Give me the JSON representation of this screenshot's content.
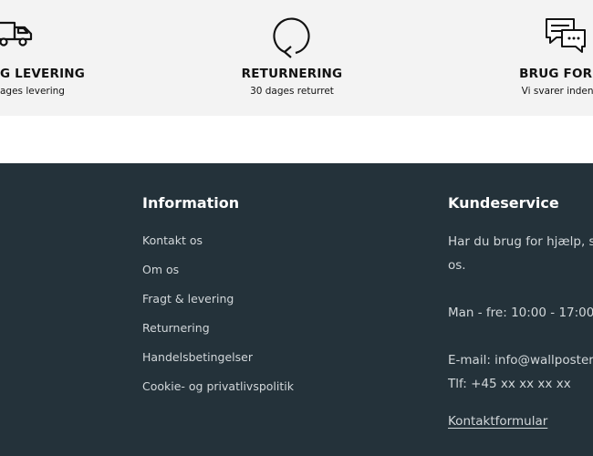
{
  "features": [
    {
      "icon": "delivery-truck-icon",
      "title": "G LEVERING",
      "subtitle": "ages levering"
    },
    {
      "icon": "return-arrow-icon",
      "title": "RETURNERING",
      "subtitle": "30 dages returret"
    },
    {
      "icon": "chat-bubbles-icon",
      "title": "BRUG FOR HJ",
      "subtitle": "Vi svarer inden for"
    }
  ],
  "footer": {
    "information": {
      "title": "Information",
      "links": [
        "Kontakt os",
        "Om os",
        "Fragt & levering",
        "Returnering",
        "Handelsbetingelser",
        "Cookie- og privatlivspolitik"
      ]
    },
    "kundeservice": {
      "title": "Kundeservice",
      "help_line1": "Har du brug for hjælp, så",
      "help_line2": "os.",
      "hours": "Man - fre: 10:00 - 17:00",
      "email": "E-mail: info@wallposters",
      "phone": "Tlf: +45 xx xx xx xx",
      "form_link": "Kontaktformular"
    }
  },
  "colors": {
    "footer_bg": "#24323a",
    "features_bg": "#f3f3f3",
    "text_dark": "#121212"
  }
}
